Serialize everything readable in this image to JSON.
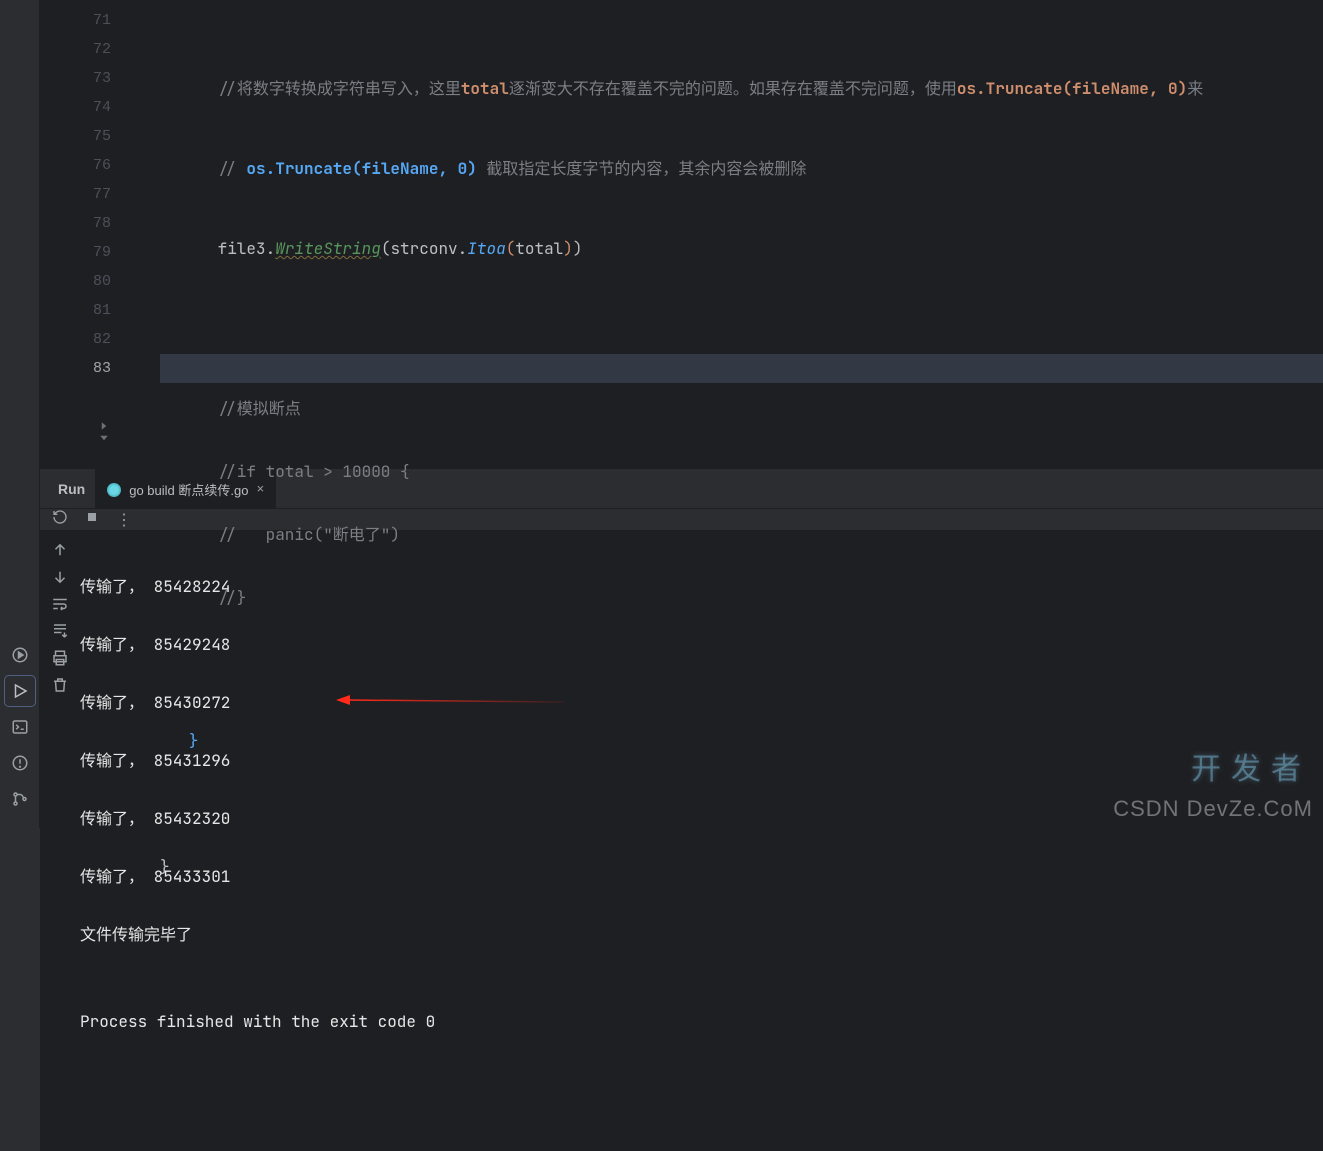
{
  "editor": {
    "line_numbers": [
      "71",
      "72",
      "73",
      "74",
      "75",
      "76",
      "77",
      "78",
      "79",
      "80",
      "81",
      "82",
      "83"
    ],
    "current_line_index": 12,
    "tokens": {
      "line71": {
        "comment_pre": "//",
        "zh1": "将数字转换成字符串写入，这里",
        "b1": "total",
        "zh2": "逐渐变大不存在覆盖不完的问题。如果存在覆盖不完问题，使用",
        "b2": "os.Truncate(fileName, 0)",
        "zh3": "来"
      },
      "line72": {
        "comment_pre": "//",
        "code": " os.Truncate(fileName, 0) ",
        "zh": "截取指定长度字节的内容，其余内容会被删除"
      },
      "line73": {
        "id": "file3",
        "dot": ".",
        "fn": "WriteString",
        "open": "(",
        "sub": "strconv",
        "dot2": ".",
        "fn2": "Itoa",
        "open2": "(",
        "var": "total",
        "close2": ")",
        "close": ")"
      },
      "line75": {
        "c": "//模拟断点"
      },
      "line76": {
        "c": "//if total > 10000 {"
      },
      "line77": {
        "c": "//   panic(\"断电了\")"
      },
      "line78": {
        "c": "//}"
      },
      "brace80": "}",
      "brace82": "}"
    }
  },
  "run": {
    "panel_label": "Run",
    "tab_label": "go build 断点续传.go",
    "console_lines": [
      "传输了， 85428224",
      "传输了， 85429248",
      "传输了， 85430272",
      "传输了， 85431296",
      "传输了， 85432320",
      "传输了， 85433301",
      "文件传输完毕了",
      "",
      "Process finished with the exit code 0"
    ]
  },
  "watermark": {
    "w1": "开发者",
    "w2": "CSDN DevZe.CoM"
  }
}
